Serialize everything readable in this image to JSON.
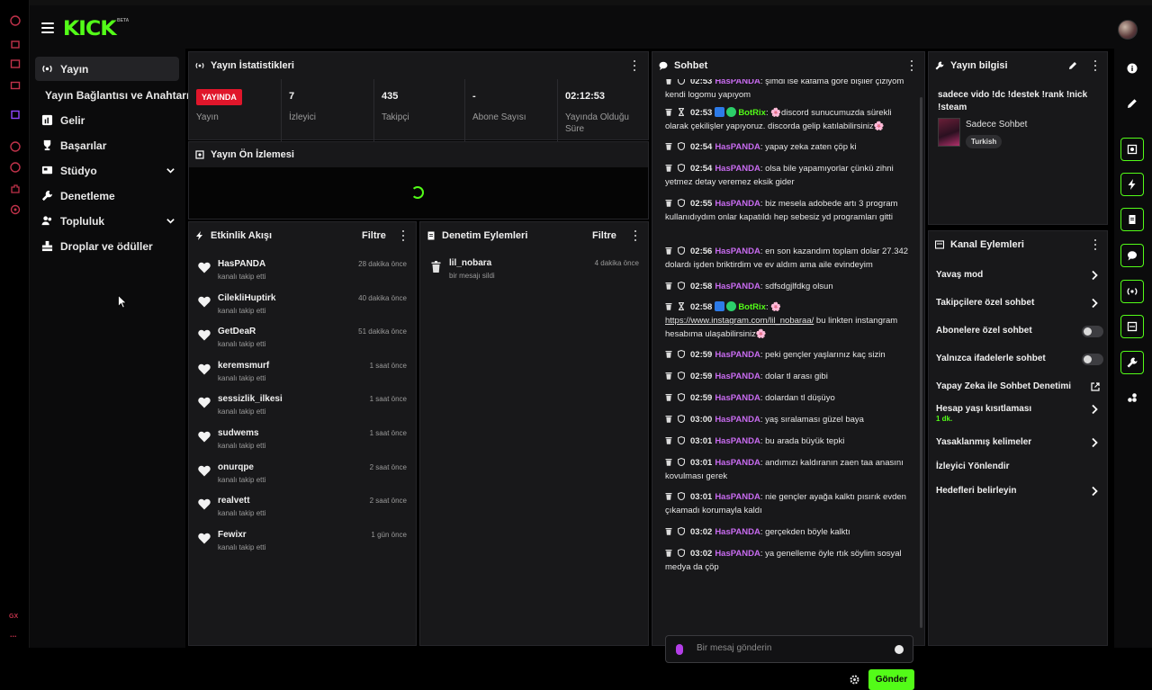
{
  "header": {
    "logo": "KICK",
    "logo_badge": "BETA"
  },
  "browser_rail": {
    "bottom_label": "GX",
    "more": "..."
  },
  "nav": {
    "items": [
      {
        "label": "Yayın",
        "icon": "broadcast-icon",
        "active": true
      },
      {
        "label": "Yayın Bağlantısı ve Anahtarı",
        "icon": "",
        "sub": true
      },
      {
        "label": "Gelir",
        "icon": "chart-icon"
      },
      {
        "label": "Başarılar",
        "icon": "trophy-icon"
      },
      {
        "label": "Stüdyo",
        "icon": "studio-icon",
        "expandable": true
      },
      {
        "label": "Denetleme",
        "icon": "wrench-icon"
      },
      {
        "label": "Topluluk",
        "icon": "people-icon",
        "expandable": true
      },
      {
        "label": "Droplar ve ödüller",
        "icon": "gift-icon"
      }
    ]
  },
  "stats": {
    "title": "Yayın İstatistikleri",
    "live_badge": "YAYINDA",
    "live_label": "Yayın",
    "items": [
      {
        "value": "7",
        "label": "İzleyici"
      },
      {
        "value": "435",
        "label": "Takipçi"
      },
      {
        "value": "-",
        "label": "Abone Sayısı"
      },
      {
        "value": "02:12:53",
        "label": "Yayında Olduğu Süre"
      }
    ]
  },
  "preview": {
    "title": "Yayın Ön İzlemesi"
  },
  "activity": {
    "title": "Etkinlik Akışı",
    "filter": "Filtre",
    "items": [
      {
        "name": "HasPANDA",
        "sub": "kanalı takip etti",
        "time": "28 dakika önce"
      },
      {
        "name": "CilekliHuptirk",
        "sub": "kanalı takip etti",
        "time": "40 dakika önce"
      },
      {
        "name": "GetDeaR",
        "sub": "kanalı takip etti",
        "time": "51 dakika önce"
      },
      {
        "name": "keremsmurf",
        "sub": "kanalı takip etti",
        "time": "1 saat önce"
      },
      {
        "name": "sessizlik_ilkesi",
        "sub": "kanalı takip etti",
        "time": "1 saat önce"
      },
      {
        "name": "sudwems",
        "sub": "kanalı takip etti",
        "time": "1 saat önce"
      },
      {
        "name": "onurqpe",
        "sub": "kanalı takip etti",
        "time": "2 saat önce"
      },
      {
        "name": "realvett",
        "sub": "kanalı takip etti",
        "time": "2 saat önce"
      },
      {
        "name": "Fewixr",
        "sub": "kanalı takip etti",
        "time": "1 gün önce"
      }
    ]
  },
  "moderation": {
    "title": "Denetim Eylemleri",
    "filter": "Filtre",
    "items": [
      {
        "name": "lil_nobara",
        "sub": "bir mesajı sildi",
        "time": "4 dakika önce"
      }
    ]
  },
  "chat": {
    "title": "Sohbet",
    "input_placeholder": "Bir mesaj gönderin",
    "send": "Gönder",
    "messages": [
      {
        "time": "02:53",
        "user": "HasPANDA",
        "text": ": şimdi ise kafama göre bişiler çiziyom kendi logomu yapıyom"
      },
      {
        "time": "02:53",
        "user": "BotRix",
        "bot": true,
        "text": ": 🌸discord sunucumuzda sürekli olarak çekilişler yapıyoruz. discorda gelip katılabilirsiniz🌸"
      },
      {
        "time": "02:54",
        "user": "HasPANDA",
        "text": ": yapay zeka zaten çöp ki"
      },
      {
        "time": "02:54",
        "user": "HasPANDA",
        "text": ": olsa bile yapamıyorlar çünkü zihni yetmez detay veremez eksik gider"
      },
      {
        "time": "02:55",
        "user": "HasPANDA",
        "text": ": biz mesela adobede artı 3 program kullanıdıydım onlar kapatıldı hep sebesiz yd programları gitti"
      },
      {
        "time": "02:56",
        "user": "HasPANDA",
        "text": ": en son kazandım toplam dolar 27.342 dolardı işden briktirdim ve ev aldım ama aile evindeyim"
      },
      {
        "time": "02:58",
        "user": "HasPANDA",
        "text": ": sdfsdgjlfdkg olsun"
      },
      {
        "time": "02:58",
        "user": "BotRix",
        "bot": true,
        "text": ": 🌸",
        "link": "https://www.instagram.com/lil_nobaraa/",
        "text2": " bu linkten instangram hesabıma ulaşabilirsiniz🌸"
      },
      {
        "time": "02:59",
        "user": "HasPANDA",
        "text": ": peki gençler yaşlarınız kaç sizin"
      },
      {
        "time": "02:59",
        "user": "HasPANDA",
        "text": ": dolar tl arası gibi"
      },
      {
        "time": "02:59",
        "user": "HasPANDA",
        "text": ": dolardan tl düşüyo"
      },
      {
        "time": "03:00",
        "user": "HasPANDA",
        "text": ": yaş sıralaması güzel baya"
      },
      {
        "time": "03:01",
        "user": "HasPANDA",
        "text": ": bu arada büyük tepki"
      },
      {
        "time": "03:01",
        "user": "HasPANDA",
        "text": ": andımızı kaldıranın zaen taa anasını kovulması gerek"
      },
      {
        "time": "03:01",
        "user": "HasPANDA",
        "text": ": nie gençler ayağa kalktı pısırık evden çıkamadı korumayla kaldı"
      },
      {
        "time": "03:02",
        "user": "HasPANDA",
        "text": ": gerçekden böyle kalktı"
      },
      {
        "time": "03:02",
        "user": "HasPANDA",
        "text": ": ya genelleme öyle rtık söylim sosyal medya da çöp"
      }
    ]
  },
  "info": {
    "title": "Yayın bilgisi",
    "stream_title": "sadece vido !dc !destek !rank !nick !steam",
    "category": "Sadece Sohbet",
    "tag": "Turkish"
  },
  "channel_actions": {
    "title": "Kanal Eylemleri",
    "items": [
      {
        "label": "Yavaş mod",
        "kind": "chevron"
      },
      {
        "label": "Takipçilere özel sohbet",
        "kind": "chevron"
      },
      {
        "label": "Abonelere özel sohbet",
        "kind": "toggle",
        "on": false
      },
      {
        "label": "Yalnızca ifadelerle sohbet",
        "kind": "toggle",
        "on": false
      },
      {
        "label": "Yapay Zeka ile Sohbet Denetimi",
        "kind": "external"
      },
      {
        "label": "Hesap yaşı kısıtlaması",
        "kind": "chevron",
        "sub": "1 dk."
      },
      {
        "label": "Yasaklanmış kelimeler",
        "kind": "chevron"
      },
      {
        "label": "İzleyici Yönlendir",
        "kind": "none"
      },
      {
        "label": "Hedefleri belirleyin",
        "kind": "chevron"
      }
    ]
  },
  "colors": {
    "accent": "#53fc18",
    "live": "#e0162b",
    "username": "#c86bf0",
    "panel": "#18181a"
  }
}
